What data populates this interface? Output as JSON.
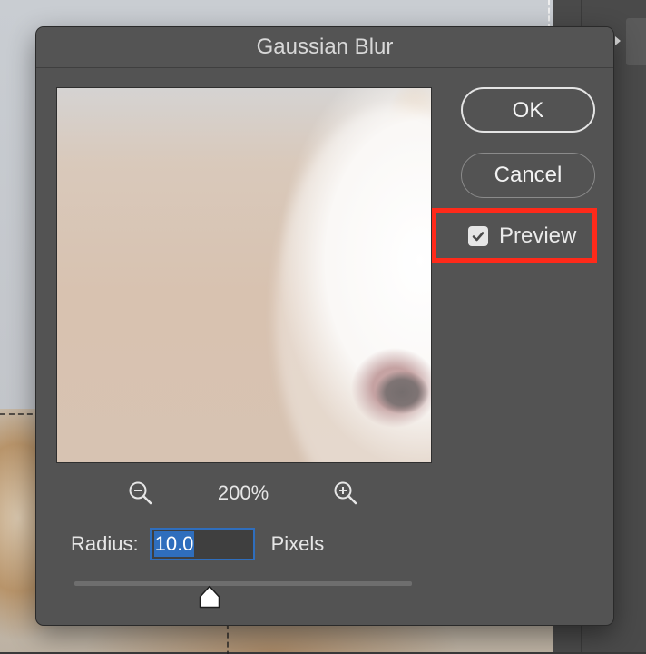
{
  "dialog": {
    "title": "Gaussian Blur",
    "ok_label": "OK",
    "cancel_label": "Cancel",
    "preview_label": "Preview",
    "preview_checked": true,
    "zoom": "200%",
    "radius_label": "Radius:",
    "radius_value": "10.0",
    "radius_units": "Pixels",
    "slider_fraction": 0.4
  },
  "icons": {
    "zoom_out": "zoom-out-icon",
    "zoom_in": "zoom-in-icon",
    "checkmark": "checkmark-icon",
    "panel_arrow": "chevron-right-icon"
  },
  "colors": {
    "dialog_bg": "#535353",
    "highlight": "#ff2a1a",
    "selection": "#2f6ebd"
  }
}
